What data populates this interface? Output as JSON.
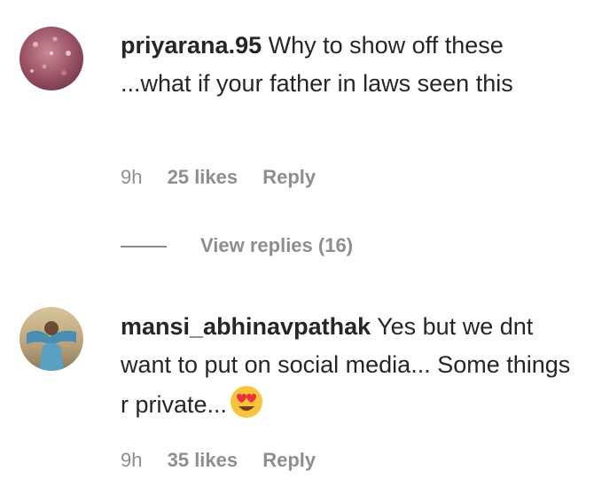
{
  "comments": [
    {
      "username": "priyarana.95",
      "text": " Why to show off these ...what if your father in laws seen this",
      "time": "9h",
      "likes": "25 likes",
      "reply_label": "Reply",
      "view_replies": "View replies (16)"
    },
    {
      "username": "mansi_abhinavpathak",
      "text": " Yes but we dnt want to put on social media... Some things r private...",
      "emoji": "heart-eyes-emoji",
      "time": "9h",
      "likes": "35 likes",
      "reply_label": "Reply"
    }
  ]
}
